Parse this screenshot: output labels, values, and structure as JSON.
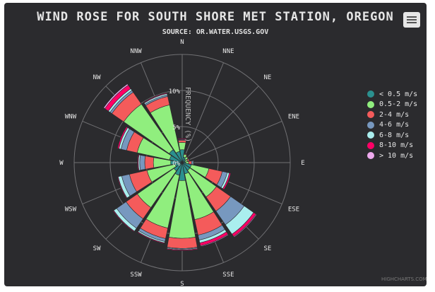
{
  "chart_data": {
    "type": "windrose",
    "title": "WIND ROSE FOR SOUTH SHORE MET STATION, OREGON",
    "subtitle": "SOURCE: OR.WATER.USGS.GOV",
    "axis_title": "FREQUENCY (%)",
    "radial_ticks": [
      "0%",
      "5%",
      "10%"
    ],
    "ylim": [
      0,
      15
    ],
    "grid": true,
    "legend_position": "right",
    "categories": [
      "N",
      "NNE",
      "NE",
      "ENE",
      "E",
      "ESE",
      "SE",
      "SSE",
      "S",
      "SSW",
      "SW",
      "WSW",
      "W",
      "WNW",
      "NW",
      "NNW"
    ],
    "series": [
      {
        "name": "< 0.5 m/s",
        "color": "#2b908f",
        "values": [
          1.8,
          0.8,
          0.6,
          0.4,
          0.5,
          1.3,
          1.3,
          1.6,
          2.5,
          1.8,
          1.4,
          1.0,
          1.6,
          1.8,
          2.2,
          1.6
        ]
      },
      {
        "name": "0.5-2 m/s",
        "color": "#90ee7e",
        "values": [
          1.0,
          0.4,
          0.4,
          0.4,
          0.4,
          2.5,
          4.5,
          6.5,
          8.0,
          7.5,
          6.2,
          4.0,
          2.4,
          4.6,
          7.7,
          6.6
        ]
      },
      {
        "name": "2-4 m/s",
        "color": "#f45b5b",
        "values": [
          0.3,
          0.1,
          0.1,
          0.2,
          0.4,
          1.9,
          2.4,
          2.2,
          1.4,
          1.5,
          1.9,
          2.5,
          1.2,
          1.5,
          2.0,
          1.2
        ]
      },
      {
        "name": "4-6 m/s",
        "color": "#7798bf",
        "values": [
          0.1,
          0.05,
          0.05,
          0.1,
          0.2,
          0.7,
          2.3,
          0.7,
          0.1,
          0.4,
          1.6,
          1.1,
          0.7,
          0.8,
          0.3,
          0.2
        ]
      },
      {
        "name": "6-8 m/s",
        "color": "#aaeeee",
        "values": [
          0.05,
          0,
          0,
          0.05,
          0.1,
          0.3,
          1.6,
          0.4,
          0.1,
          0.2,
          0.5,
          0.5,
          0.2,
          0.3,
          0.3,
          0.2
        ]
      },
      {
        "name": "8-10 m/s",
        "color": "#ff0066",
        "values": [
          0.1,
          0,
          0,
          0,
          0,
          0.2,
          0.4,
          0.4,
          0.1,
          0.1,
          0.1,
          0.1,
          0.1,
          0.2,
          0.6,
          0.1
        ]
      },
      {
        "name": "> 10 m/s",
        "color": "#eeaaee",
        "values": [
          0,
          0,
          0,
          0,
          0,
          0.05,
          0.1,
          0.1,
          0,
          0,
          0.05,
          0.05,
          0,
          0.05,
          0.2,
          0.05
        ]
      }
    ]
  },
  "credit": "HIGHCHARTS.COM",
  "colors": {
    "background": "#2b2b2e",
    "grid": "#707073",
    "text": "#e6e6e6"
  }
}
